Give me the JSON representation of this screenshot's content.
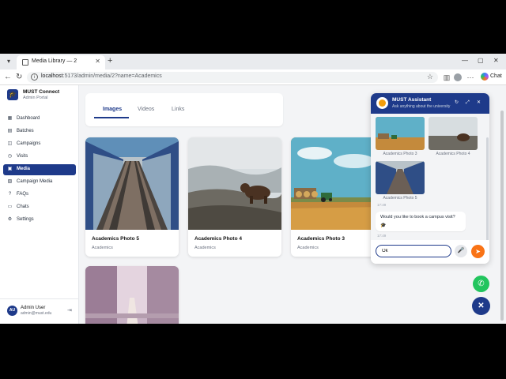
{
  "browser": {
    "tab_title": "Media Library — 2",
    "url_host": "localhost",
    "url_rest": ":5173/admin/media/2?name=Academics",
    "chat_label": "Chat"
  },
  "sidebar": {
    "brand_name": "MUST Connect",
    "brand_sub": "Admin Portal",
    "items": [
      {
        "label": "Dashboard",
        "icon": "dashboard-icon",
        "glyph": "▦"
      },
      {
        "label": "Batches",
        "icon": "batches-icon",
        "glyph": "▤"
      },
      {
        "label": "Campaigns",
        "icon": "campaigns-icon",
        "glyph": "◫"
      },
      {
        "label": "Visits",
        "icon": "visits-icon",
        "glyph": "◷"
      },
      {
        "label": "Media",
        "icon": "media-icon",
        "glyph": "▣"
      },
      {
        "label": "Campaign Media",
        "icon": "campaign-media-icon",
        "glyph": "▧"
      },
      {
        "label": "FAQs",
        "icon": "faq-icon",
        "glyph": "?"
      },
      {
        "label": "Chats",
        "icon": "chats-icon",
        "glyph": "▭"
      },
      {
        "label": "Settings",
        "icon": "settings-icon",
        "glyph": "⚙"
      }
    ],
    "active_item": "Media",
    "user": {
      "initials": "AU",
      "name": "Admin User",
      "email": "admin@must.edu"
    }
  },
  "media_tabs": [
    "Images",
    "Videos",
    "Links"
  ],
  "active_tab": "Images",
  "cards": [
    {
      "title": "Academics Photo 5",
      "category": "Academics",
      "image": "railway-tracks"
    },
    {
      "title": "Academics Photo 4",
      "category": "Academics",
      "image": "bear-on-hillside"
    },
    {
      "title": "Academics Photo 3",
      "category": "Academics",
      "image": "tractor-hay-bales"
    },
    {
      "title": "",
      "category": "",
      "image": "pink-tree-road"
    }
  ],
  "chat": {
    "title": "MUST Assistant",
    "subtitle": "Ask anything about the university",
    "thumbs": [
      {
        "caption": "Academics Photo 3"
      },
      {
        "caption": "Academics Photo 4"
      },
      {
        "caption": "Academics Photo 5"
      }
    ],
    "time1": "17:49",
    "message": "Would you like to book a campus visit?",
    "emoji": "🎓",
    "time2": "17:49",
    "input_value": "Ok"
  },
  "colors": {
    "primary": "#1e3a8a",
    "accent": "#f97316",
    "whatsapp": "#22c55e"
  }
}
